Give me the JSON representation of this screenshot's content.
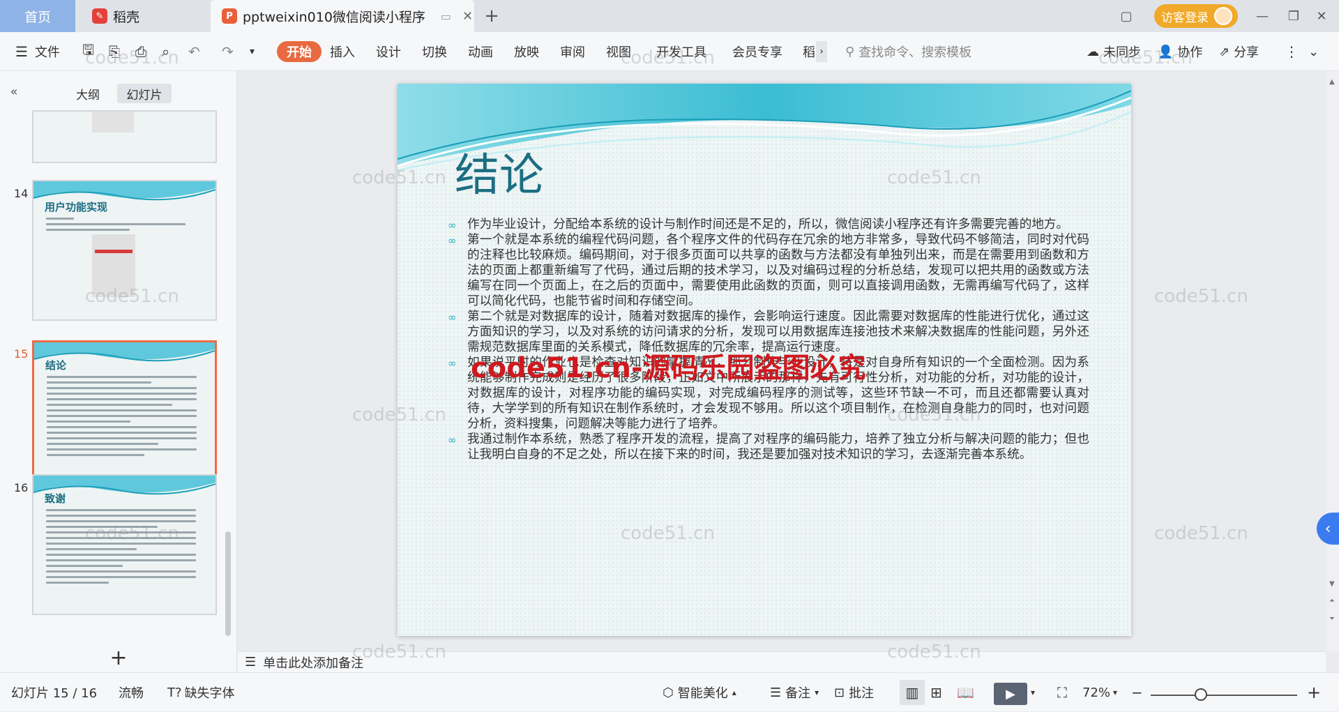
{
  "tabs": {
    "home": "首页",
    "docer": "稻壳",
    "document": "pptweixin010微信阅读小程序"
  },
  "window": {
    "login_label": "访客登录"
  },
  "toolbar": {
    "file_label": "文件",
    "ribbon_tabs": [
      "开始",
      "插入",
      "设计",
      "切换",
      "动画",
      "放映",
      "审阅",
      "视图",
      "开发工具",
      "会员专享",
      "稻"
    ],
    "search_placeholder": "查找命令、搜索模板",
    "sync_label": "未同步",
    "collab_label": "协作",
    "share_label": "分享"
  },
  "sidebar": {
    "tab_outline": "大纲",
    "tab_slides": "幻灯片",
    "thumbs": [
      {
        "number": "",
        "title": ""
      },
      {
        "number": "14",
        "title": "用户功能实现"
      },
      {
        "number": "15",
        "title": "结论"
      },
      {
        "number": "16",
        "title": "致谢"
      }
    ],
    "add_label": "+"
  },
  "slide": {
    "title": "结论",
    "bullets": [
      "作为毕业设计，分配给本系统的设计与制作时间还是不足的，所以，微信阅读小程序还有许多需要完善的地方。",
      "第一个就是本系统的编程代码问题，各个程序文件的代码存在冗余的地方非常多，导致代码不够简洁，同时对代码的注释也比较麻烦。编码期间，对于很多页面可以共享的函数与方法都没有单独列出来，而是在需要用到函数和方法的页面上都重新编写了代码，通过后期的技术学习，以及对编码过程的分析总结，发现可以把共用的函数或方法编写在同一个页面上，在之后的页面中，需要使用此函数的页面，则可以直接调用函数，无需再编写代码了，这样可以简化代码，也能节省时间和存储空间。",
      "第二个就是对数据库的设计，随着对数据库的操作，会影响运行速度。因此需要对数据库的性能进行优化，通过这方面知识的学习，以及对系统的访问请求的分析，发现可以用数据库连接池技术来解决数据库的性能问题，另外还需规范数据库里面的关系模式，降低数据库的冗余率，提高运行速度。",
      "如果说平时的作业也是检查对知识的掌握情况，那么制作毕业设计，将是对自身所有知识的一个全面检测。因为系统能够制作完成则是经历了很多阶段，正如文中所展示的那样，先有可行性分析，对功能的分析，对功能的设计，对数据库的设计，对程序功能的编码实现，对完成编码程序的测试等，这些环节缺一不可，而且还都需要认真对待，大学学到的所有知识在制作系统时，才会发现不够用。所以这个项目制作，在检测自身能力的同时，也对问题分析，资料搜集，问题解决等能力进行了培养。",
      "我通过制作本系统，熟悉了程序开发的流程，提高了对程序的编码能力，培养了独立分析与解决问题的能力；但也让我明白自身的不足之处，所以在接下来的时间，我还是要加强对技术知识的学习，去逐渐完善本系统。"
    ]
  },
  "notes": {
    "placeholder": "单击此处添加备注"
  },
  "statusbar": {
    "slide_counter": "幻灯片 15 / 16",
    "smooth_label": "流畅",
    "missing_font_label": "缺失字体",
    "beautify_label": "智能美化",
    "notes_label": "备注",
    "comment_label": "批注",
    "zoom": "72%"
  },
  "watermarks": {
    "small": "code51.cn",
    "big": "code51.cn-源码乐园盗图必究"
  },
  "colors": {
    "accent": "#e86a40",
    "slide_title": "#1b6e82",
    "bullet_mark": "#20b2c8",
    "login": "#f0a92b"
  }
}
